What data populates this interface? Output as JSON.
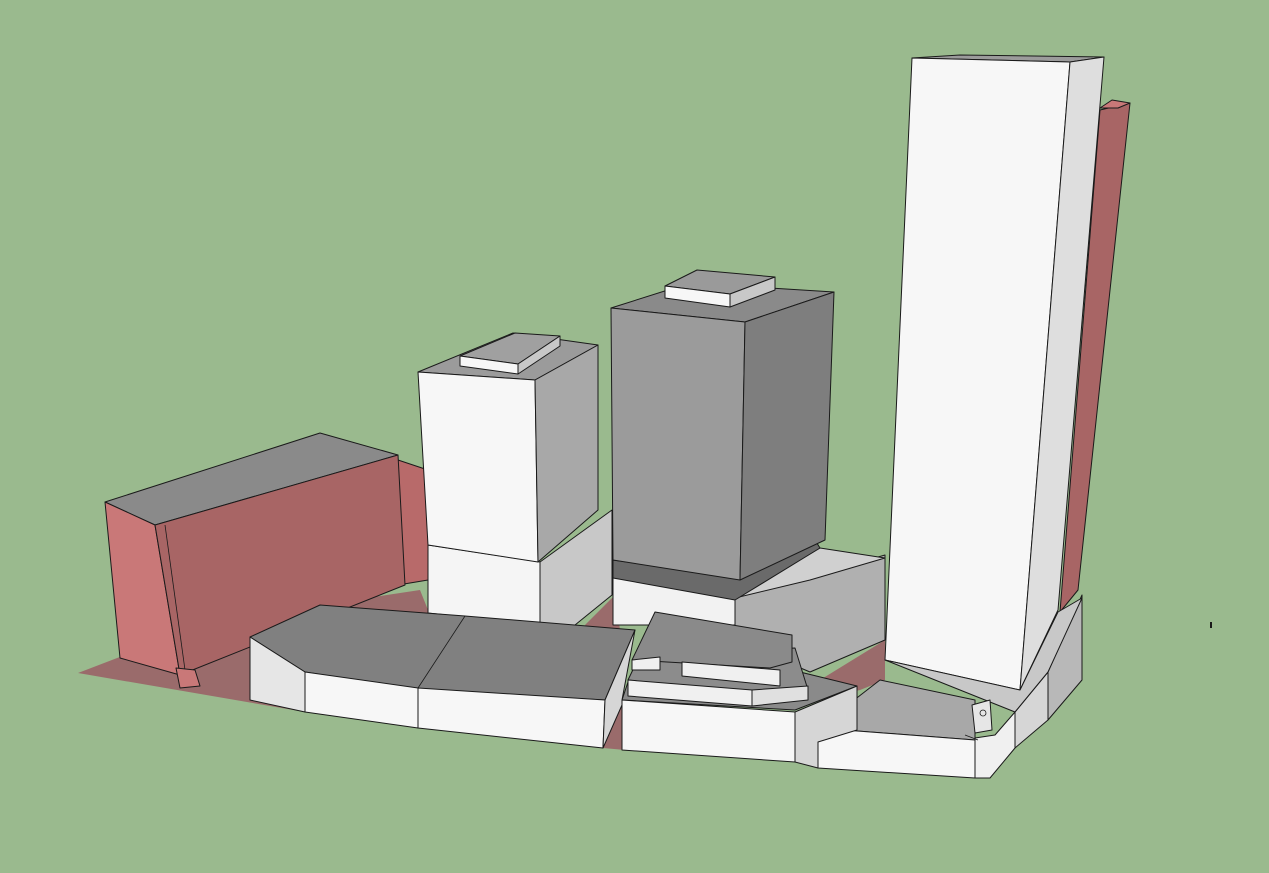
{
  "scene": {
    "background_color": "#9aba8e",
    "colors": {
      "white_face": "#f7f7f7",
      "light_gray_face": "#c8c8c8",
      "mid_gray_face": "#9b9b9b",
      "dark_gray_face": "#7e7e7e",
      "roof_gray": "#8a8a8a",
      "red_face_front": "#a86565",
      "red_face_side": "#c97878",
      "shadow": "#9a6b6b",
      "edge": "#1a1a1a"
    },
    "buildings": [
      "red-block-left",
      "low-podium-front-left",
      "white-tower-center-left",
      "gray-tower-center",
      "stepped-podium-center",
      "tall-white-tower-right",
      "red-slab-far-right",
      "corner-podium-right"
    ]
  }
}
